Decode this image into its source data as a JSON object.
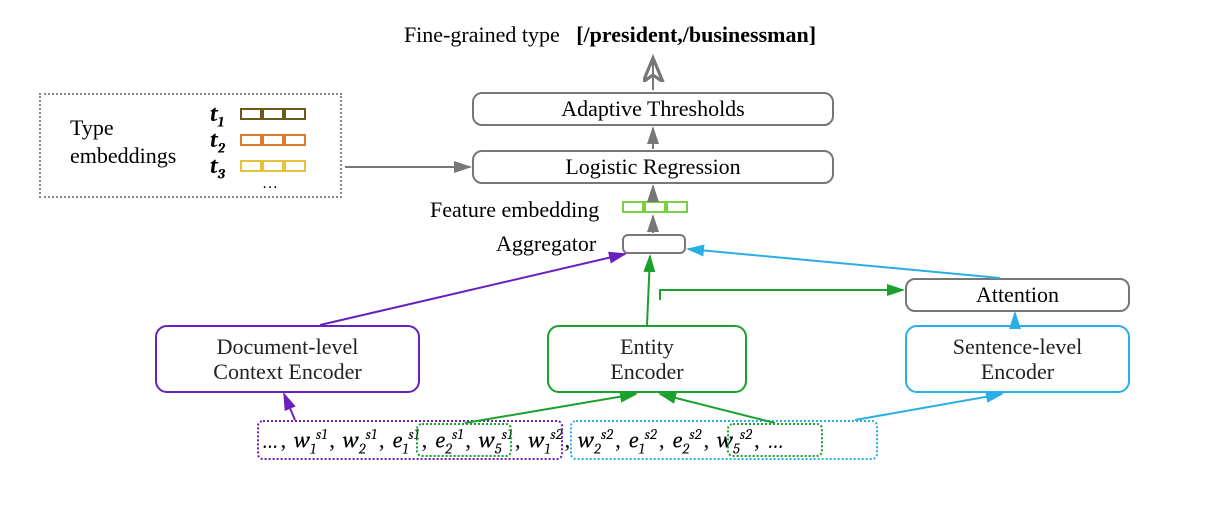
{
  "title": {
    "label": "Fine-grained type",
    "output": "[/president,/businessman]"
  },
  "blocks": {
    "adaptive": "Adaptive Thresholds",
    "logistic": "Logistic Regression",
    "feature_label": "Feature embedding",
    "aggregator_label": "Aggregator",
    "attention": "Attention",
    "doc_encoder_l1": "Document-level",
    "doc_encoder_l2": "Context Encoder",
    "entity_encoder_l1": "Entity",
    "entity_encoder_l2": "Encoder",
    "sent_encoder_l1": "Sentence-level",
    "sent_encoder_l2": "Encoder"
  },
  "type_embeddings": {
    "label_l1": "Type",
    "label_l2": "embeddings",
    "rows": [
      "t",
      "t",
      "t"
    ],
    "subs": [
      "1",
      "2",
      "3"
    ],
    "ellipsis": "…",
    "colors": [
      "#6b5b1a",
      "#e07a2a",
      "#e6c23a"
    ]
  },
  "feature_color": "#7ccf3f",
  "tokens": {
    "pre_ellipsis": "…",
    "w1s1": {
      "base": "w",
      "sub": "1",
      "sup": "s1"
    },
    "w2s1": {
      "base": "w",
      "sub": "2",
      "sup": "s1"
    },
    "e1s1": {
      "base": "e",
      "sub": "1",
      "sup": "s1"
    },
    "e2s1": {
      "base": "e",
      "sub": "2",
      "sup": "s1"
    },
    "w5s1": {
      "base": "w",
      "sub": "5",
      "sup": "s1"
    },
    "w1s2": {
      "base": "w",
      "sub": "1",
      "sup": "s2"
    },
    "w2s2": {
      "base": "w",
      "sub": "2",
      "sup": "s2"
    },
    "e1s2": {
      "base": "e",
      "sub": "1",
      "sup": "s2"
    },
    "e2s2": {
      "base": "e",
      "sub": "2",
      "sup": "s2"
    },
    "w5s2": {
      "base": "w",
      "sub": "5",
      "sup": "s2"
    },
    "post_ellipsis": "…"
  }
}
